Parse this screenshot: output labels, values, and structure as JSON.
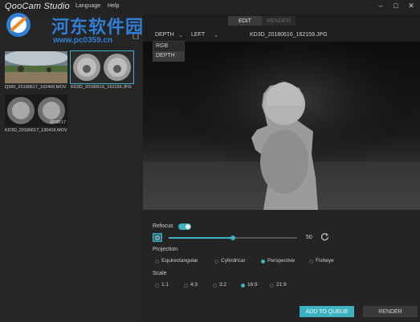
{
  "app": {
    "title": "QooCam Studio",
    "menu": [
      "Language",
      "Help"
    ],
    "window_controls": [
      "–",
      "□",
      "✕"
    ]
  },
  "watermark": {
    "title": "河东软件园",
    "url": "www.pc0359.cn"
  },
  "library": {
    "items": [
      {
        "caption": "Q360_20180617_152400.MOV",
        "selected": false,
        "badge": ""
      },
      {
        "caption": "KD3D_20180616_162159.JPG",
        "selected": true,
        "badge": ""
      },
      {
        "caption": "KD3D_20180617_130416.MOV",
        "selected": false,
        "badge": "00:00:17"
      }
    ]
  },
  "mode_tabs": {
    "edit": "EDIT",
    "render": "RENDER"
  },
  "toolbar": {
    "view_mode": "DEPTH",
    "eye": "LEFT",
    "filename": "KD3D_20180616_162159.JPG"
  },
  "view_menu": {
    "options": [
      "RGB",
      "DEPTH"
    ],
    "selected": "DEPTH"
  },
  "refocus": {
    "label": "Refocus",
    "enabled": true,
    "value": "50",
    "value_fraction": 0.5
  },
  "projection": {
    "label": "Projection",
    "options": [
      "Equirectangular",
      "Cylindrical",
      "Perspective",
      "Fisheye"
    ],
    "selected": "Perspective"
  },
  "scale": {
    "label": "Scale",
    "options": [
      "1:1",
      "4:3",
      "3:2",
      "16:9",
      "21:9"
    ],
    "selected": "16:9"
  },
  "actions": {
    "add_to_queue": "ADD TO QUEUE",
    "render": "RENDER"
  },
  "colors": {
    "accent": "#3fb2c2",
    "background": "#1e1e1e",
    "watermark": "#2f7fd6"
  }
}
